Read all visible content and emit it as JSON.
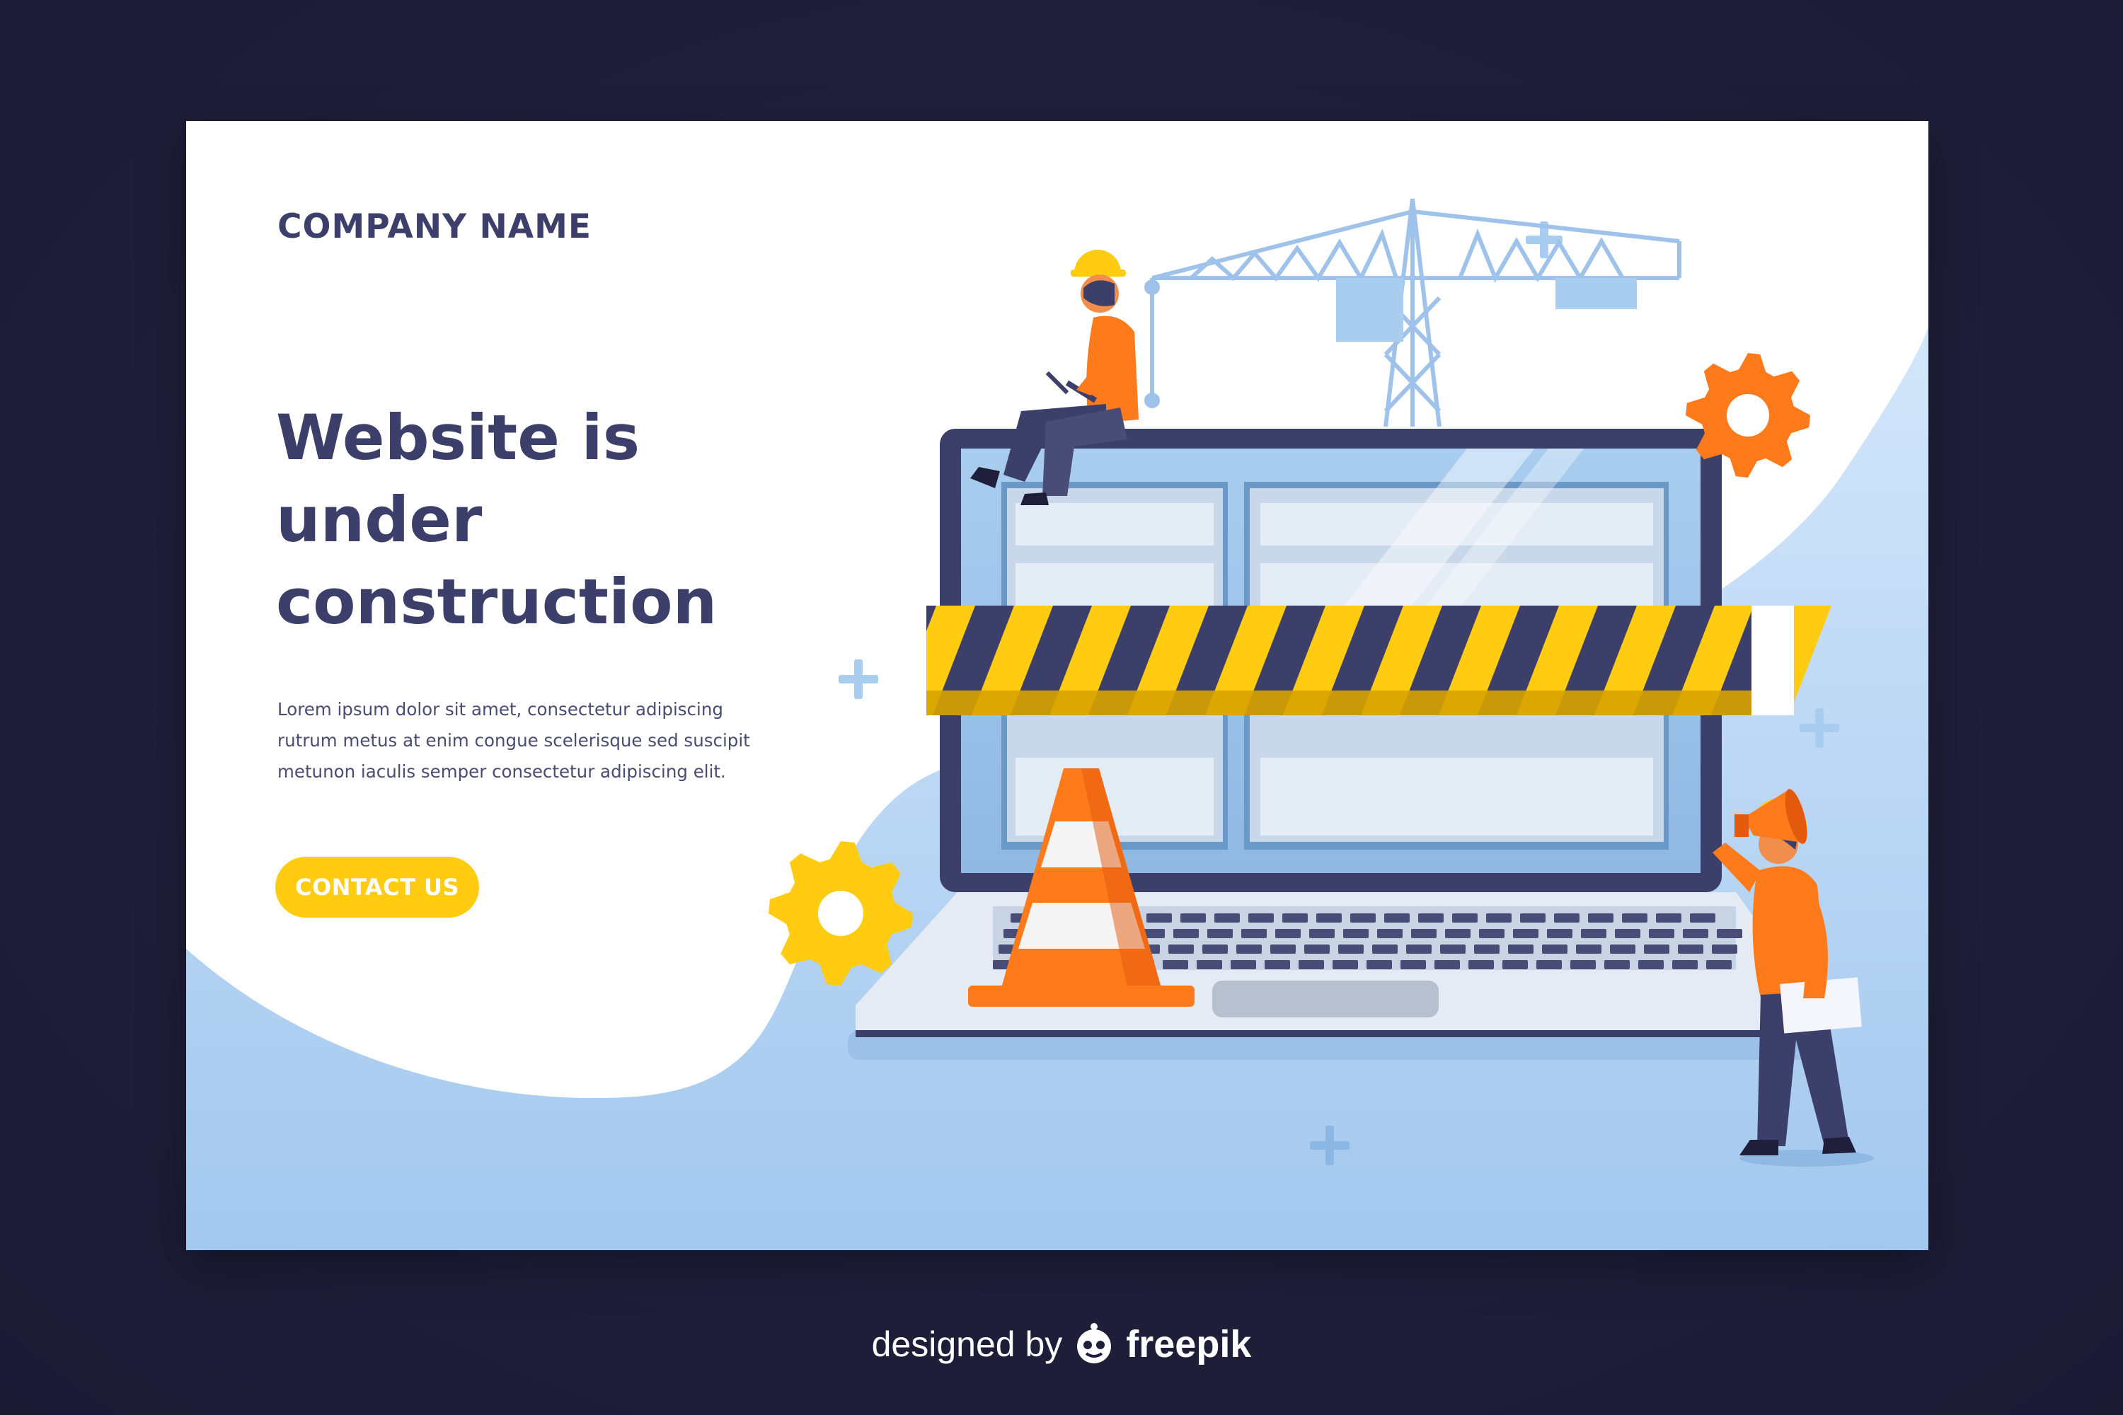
{
  "colors": {
    "background": "#1f1f3b",
    "heading": "#3d3f6b",
    "accent_yellow": "#ffcc12",
    "accent_orange": "#ff7a1a",
    "light_blue": "#a9cdf0"
  },
  "header": {
    "company_name": "COMPANY NAME"
  },
  "hero": {
    "headline_lines": [
      "Website is",
      "under",
      "construction"
    ],
    "description_lines": [
      "Lorem ipsum dolor sit amet, consectetur adipiscing",
      "rutrum metus at enim congue scelerisque sed suscipit",
      "metunon iaculis semper consectetur adipiscing elit."
    ],
    "cta_label": "CONTACT US"
  },
  "illustration": {
    "elements": [
      "crane",
      "laptop",
      "caution-tape",
      "traffic-cone",
      "gears",
      "workers",
      "megaphone",
      "plus-signs"
    ]
  },
  "footer": {
    "credit_text": "designed by",
    "brand": "freepik",
    "brand_icon": "freepik-logo-icon"
  }
}
